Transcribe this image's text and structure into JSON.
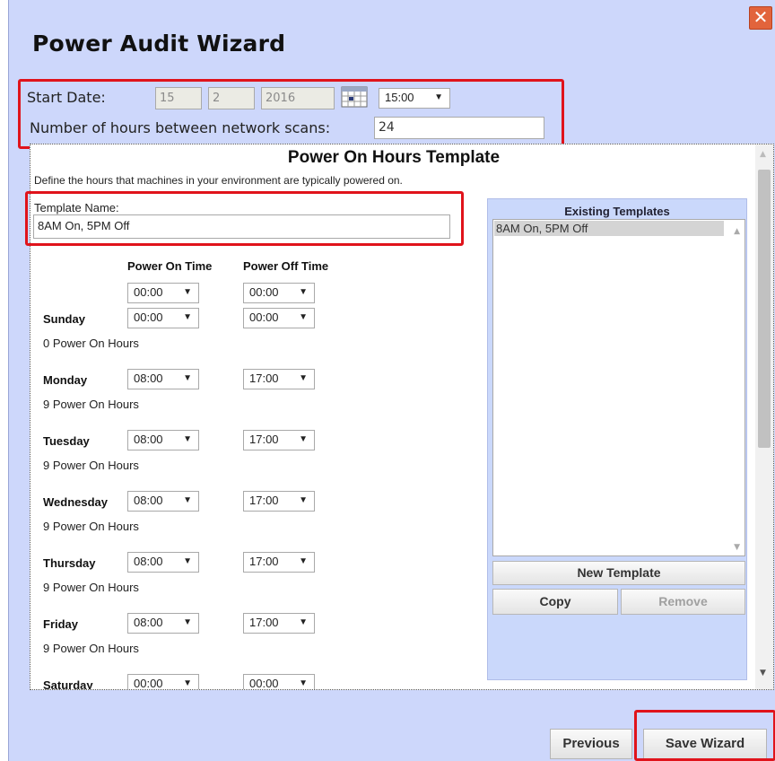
{
  "dialog": {
    "title": "Power Audit Wizard",
    "close_icon": "close-icon"
  },
  "schedule": {
    "start_date_label": "Start Date:",
    "day": "15",
    "month": "2",
    "year": "2016",
    "time": "15:00",
    "scan_label": "Number of hours between network scans:",
    "scan_hours": "24"
  },
  "template": {
    "heading": "Power On Hours Template",
    "description": "Define the hours that machines in your environment are typically powered on.",
    "name_label": "Template Name:",
    "name_value": "8AM On, 5PM Off",
    "on_header": "Power On Time",
    "off_header": "Power Off Time",
    "extra_row": {
      "on": "00:00",
      "off": "00:00"
    },
    "days": [
      {
        "name": "Sunday",
        "on": "00:00",
        "off": "00:00",
        "hours": "0 Power On Hours"
      },
      {
        "name": "Monday",
        "on": "08:00",
        "off": "17:00",
        "hours": "9 Power On Hours"
      },
      {
        "name": "Tuesday",
        "on": "08:00",
        "off": "17:00",
        "hours": "9 Power On Hours"
      },
      {
        "name": "Wednesday",
        "on": "08:00",
        "off": "17:00",
        "hours": "9 Power On Hours"
      },
      {
        "name": "Thursday",
        "on": "08:00",
        "off": "17:00",
        "hours": "9 Power On Hours"
      },
      {
        "name": "Friday",
        "on": "08:00",
        "off": "17:00",
        "hours": "9 Power On Hours"
      },
      {
        "name": "Saturday",
        "on": "00:00",
        "off": "00:00",
        "hours": ""
      }
    ]
  },
  "existing": {
    "heading": "Existing Templates",
    "items": [
      "8AM On, 5PM Off"
    ],
    "new_label": "New Template",
    "copy_label": "Copy",
    "remove_label": "Remove"
  },
  "footer": {
    "previous_label": "Previous",
    "save_label": "Save Wizard"
  },
  "colors": {
    "highlight": "#e0131b",
    "dialog_bg": "#cdd7fb",
    "close_bg": "#e2643c"
  }
}
